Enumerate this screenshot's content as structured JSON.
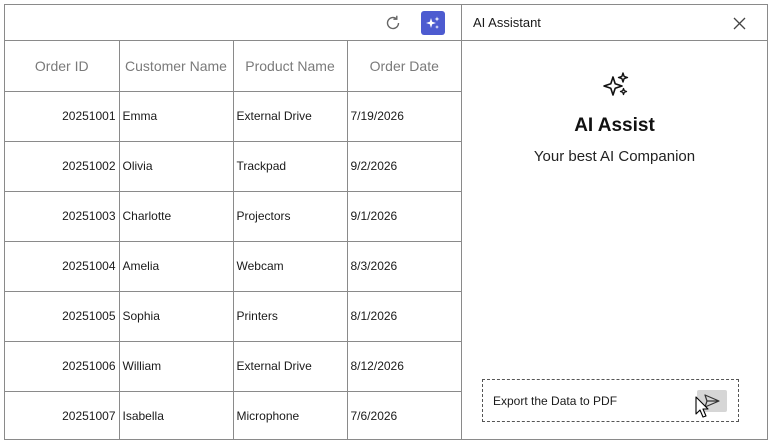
{
  "grid": {
    "columns": [
      "Order ID",
      "Customer Name",
      "Product Name",
      "Order Date"
    ],
    "rows": [
      [
        "20251001",
        "Emma",
        "External Drive",
        "7/19/2026"
      ],
      [
        "20251002",
        "Olivia",
        "Trackpad",
        "9/2/2026"
      ],
      [
        "20251003",
        "Charlotte",
        "Projectors",
        "9/1/2026"
      ],
      [
        "20251004",
        "Amelia",
        "Webcam",
        "8/3/2026"
      ],
      [
        "20251005",
        "Sophia",
        "Printers",
        "8/1/2026"
      ],
      [
        "20251006",
        "William",
        "External Drive",
        "8/12/2026"
      ],
      [
        "20251007",
        "Isabella",
        "Microphone",
        "7/6/2026"
      ]
    ]
  },
  "toolbar": {
    "refresh_icon": "refresh-icon",
    "ai_icon": "sparkle-icon",
    "ai_button_color": "#4d5bd0"
  },
  "assistant": {
    "title": "AI Assistant",
    "heading": "AI Assist",
    "subheading": "Your best AI Companion",
    "prompt_value": "Export the Data to PDF",
    "send_icon": "send-icon"
  }
}
